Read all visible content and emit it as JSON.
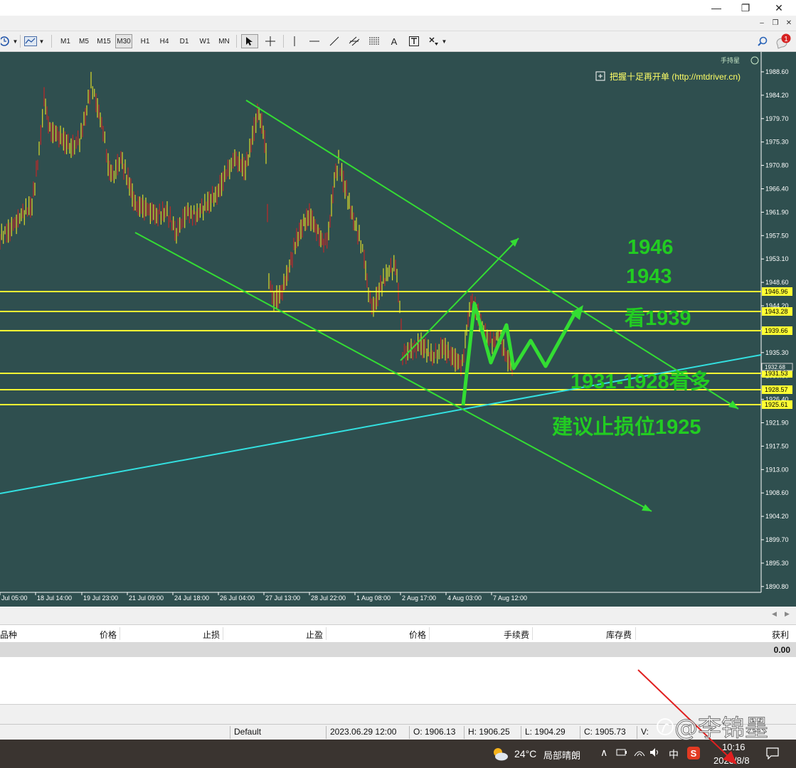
{
  "window": {
    "minimize_icon": "minimize-icon",
    "restore_icon": "restore-icon",
    "close_icon": "close-icon"
  },
  "toolbar": {
    "timeframes": [
      "M1",
      "M5",
      "M15",
      "M30",
      "H1",
      "H4",
      "D1",
      "W1",
      "MN"
    ],
    "selected_timeframe": "M30",
    "text_tool_label": "A"
  },
  "chart": {
    "corner_label": "手持星",
    "overlay_text": "把握十足再开单 (http://mtdriver.cn)",
    "price_axis": [
      "1988.60",
      "1984.20",
      "1979.70",
      "1975.30",
      "1970.80",
      "1966.40",
      "1961.90",
      "1957.50",
      "1953.10",
      "1948.60",
      "1944.20",
      "1939.70",
      "1935.30",
      "1930.80",
      "1926.40",
      "1921.90",
      "1917.50",
      "1913.00",
      "1908.60",
      "1904.20",
      "1899.70",
      "1895.30",
      "1890.80"
    ],
    "time_axis": [
      "Jul 05:00",
      "18 Jul 14:00",
      "19 Jul 23:00",
      "21 Jul 09:00",
      "24 Jul 18:00",
      "26 Jul 04:00",
      "27 Jul 13:00",
      "28 Jul 22:00",
      "1 Aug 08:00",
      "2 Aug 17:00",
      "4 Aug 03:00",
      "7 Aug 12:00"
    ],
    "level_labels": [
      "1946.96",
      "1943.28",
      "1939.66",
      "1931.53",
      "1928.57",
      "1925.61"
    ],
    "current_price_label": "1932.68",
    "annotations": {
      "a1946": "1946",
      "a1943": "1943",
      "a1939": "看1939",
      "a1931": "1931-1928看多",
      "astop": "建议止损位1925"
    },
    "colors": {
      "background": "#2f4f4f",
      "level_line": "#ffff33",
      "channel_line": "#33dd33",
      "trend_line": "#33e0e0",
      "annotation": "#22cc22"
    }
  },
  "terminal": {
    "columns": [
      "品种",
      "价格",
      "止损",
      "止盈",
      "价格",
      "手续费",
      "库存费",
      "获利"
    ],
    "profit_total": "0.00"
  },
  "statusbar": {
    "profile": "Default",
    "datetime": "2023.06.29 12:00",
    "open": "O: 1906.13",
    "high": "H: 1906.25",
    "low": "L: 1904.29",
    "close": "C: 1905.73",
    "volume": "V:"
  },
  "taskbar": {
    "temperature": "24°C",
    "weather": "局部晴朗",
    "ime": "中",
    "time": "10:16",
    "date": "2023/8/8",
    "notification_count": "1",
    "watermark": "@李锦墨"
  }
}
